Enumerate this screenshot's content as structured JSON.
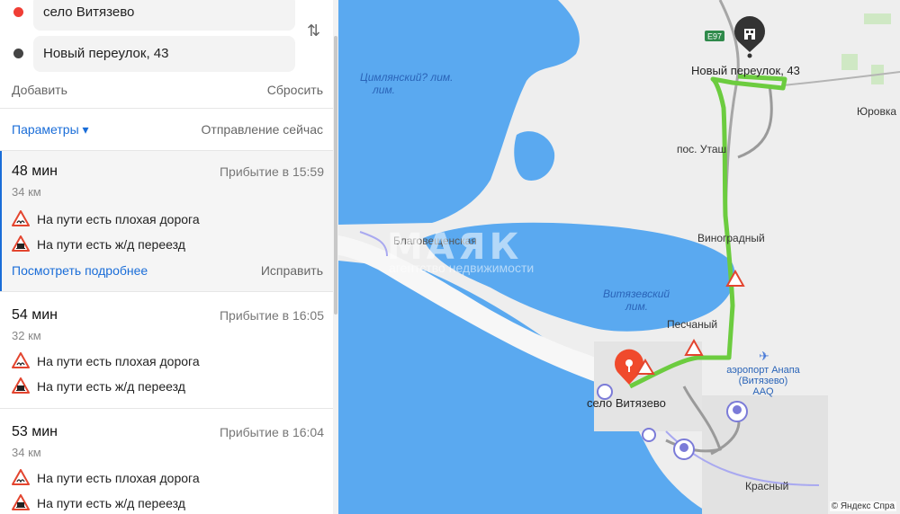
{
  "route_points": {
    "from": "село Витязево",
    "to": "Новый переулок, 43"
  },
  "actions": {
    "add": "Добавить",
    "reset": "Сбросить"
  },
  "options": {
    "params": "Параметры ▾",
    "departure": "Отправление сейчас"
  },
  "routes": [
    {
      "time": "48 мин",
      "arrival": "Прибытие в 15:59",
      "distance": "34 км",
      "warnings": [
        "На пути есть плохая дорога",
        "На пути есть ж/д переезд"
      ],
      "details": "Посмотреть подробнее",
      "fix": "Исправить"
    },
    {
      "time": "54 мин",
      "arrival": "Прибытие в 16:05",
      "distance": "32 км",
      "warnings": [
        "На пути есть плохая дорога",
        "На пути есть ж/д переезд"
      ]
    },
    {
      "time": "53 мин",
      "arrival": "Прибытие в 16:04",
      "distance": "34 км",
      "warnings": [
        "На пути есть плохая дорога",
        "На пути есть ж/д переезд"
      ]
    }
  ],
  "map": {
    "labels": {
      "tsiltashsky": "Цимлянский? лим.",
      "blagoveshchenskaya": "Благовещенская",
      "vityazevsky_liman": "Витязевский",
      "liman": "лим.",
      "novy_pereulok": "Новый переулок, 43",
      "pos_utash": "пос. Уташ",
      "vinogradny": "Виноградный",
      "peschany": "Песчаный",
      "airport_1": "аэропорт Анапа",
      "airport_2": "(Витязево)",
      "airport_3": "AAQ",
      "selo_vityazevo": "село Витязево",
      "krasny": "Красный",
      "yurovka": "Юровка",
      "road_badge": "E97"
    },
    "watermark": {
      "brand": "МАЯК",
      "tagline": "агентство недвижимости"
    },
    "copyright": "© Яндекс  Спра",
    "colors": {
      "water": "#5aa9f0",
      "land": "#eeeeee",
      "route": "#6ccc3f",
      "marker": "#f04a2c"
    }
  }
}
